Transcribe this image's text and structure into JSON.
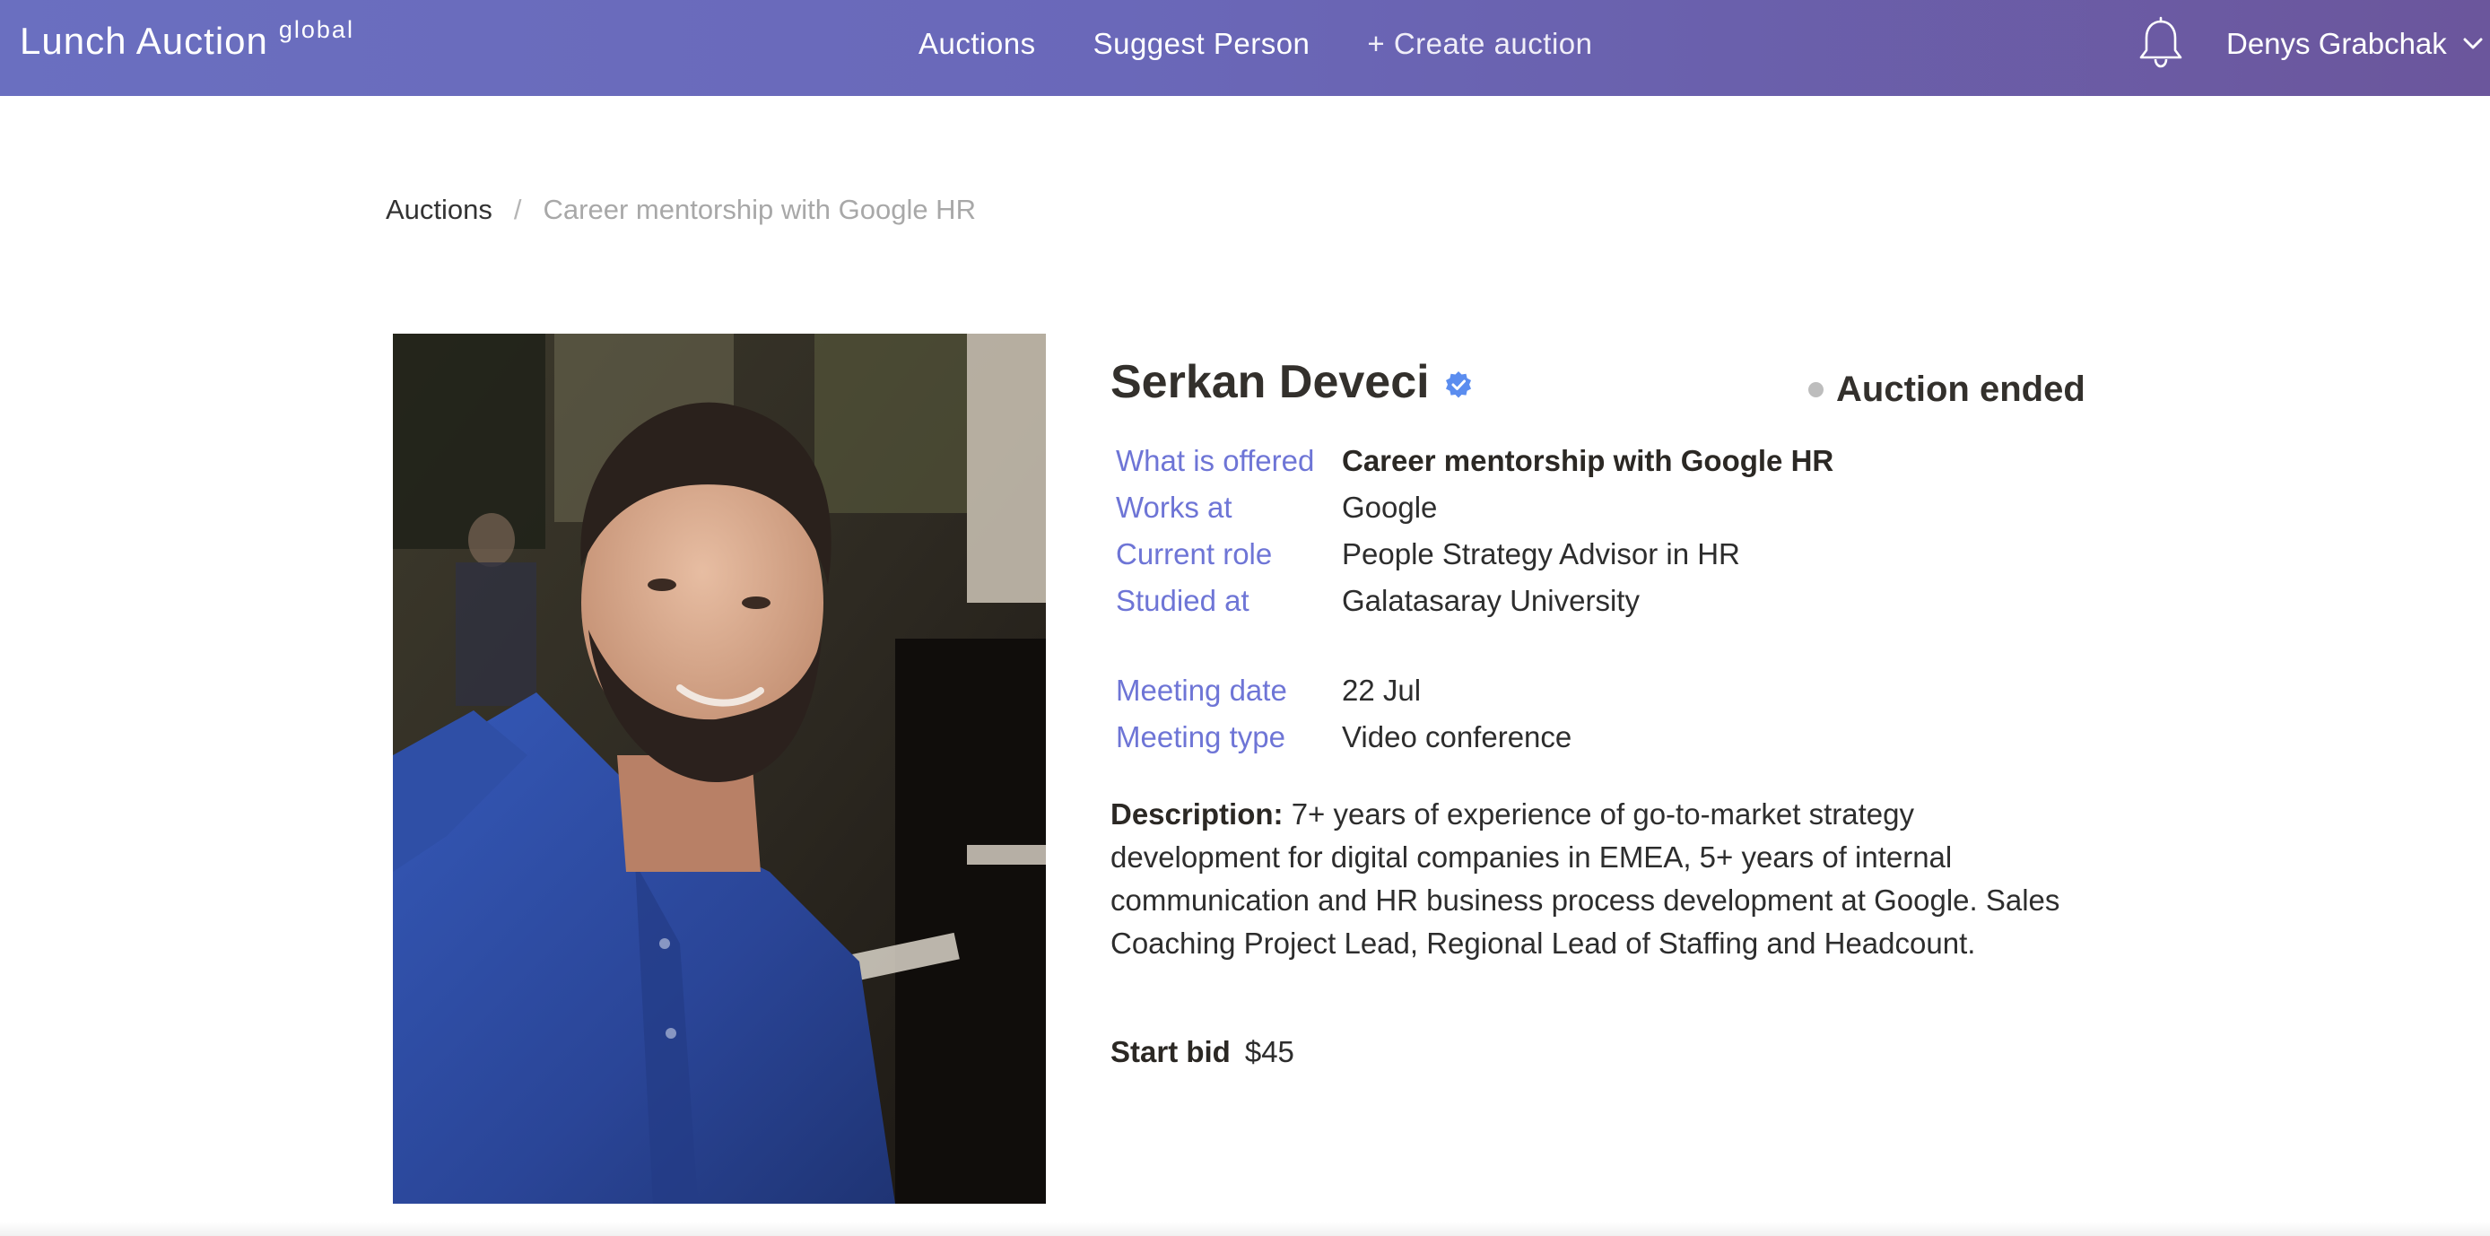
{
  "header": {
    "brand": "Lunch Auction",
    "brand_tag": "global",
    "nav": {
      "auctions": "Auctions",
      "suggest": "Suggest Person",
      "create": "+ Create auction"
    },
    "user_name": "Denys Grabchak"
  },
  "breadcrumb": {
    "parent": "Auctions",
    "separator": "/",
    "current": "Career mentorship with Google HR"
  },
  "person": {
    "name": "Serkan Deveci",
    "photo_alt": "Serkan Deveci"
  },
  "status": {
    "label": "Auction ended",
    "dot_color": "#bdbdbd"
  },
  "details": [
    {
      "label": "What is offered",
      "value": "Career mentorship with Google HR"
    },
    {
      "label": "Works at",
      "value": "Google"
    },
    {
      "label": "Current role",
      "value": "People Strategy Advisor in HR"
    },
    {
      "label": "Studied at",
      "value": "Galatasaray University"
    }
  ],
  "meeting": [
    {
      "label": "Meeting date",
      "value": "22 Jul"
    },
    {
      "label": "Meeting type",
      "value": "Video conference"
    }
  ],
  "description": {
    "label": "Description:",
    "text": "7+ years of experience of go-to-market strategy development for digital companies in EMEA, 5+ years of internal communication and HR business process development at Google. Sales Coaching Project Lead, Regional Lead of Staffing and Headcount."
  },
  "bid": {
    "label": "Start bid",
    "value": "$45"
  },
  "colors": {
    "header_gradient_start": "#6a6fc0",
    "header_gradient_end": "#6b569c",
    "label_blue": "#6e75d6",
    "verified_blue": "#5b8def"
  }
}
